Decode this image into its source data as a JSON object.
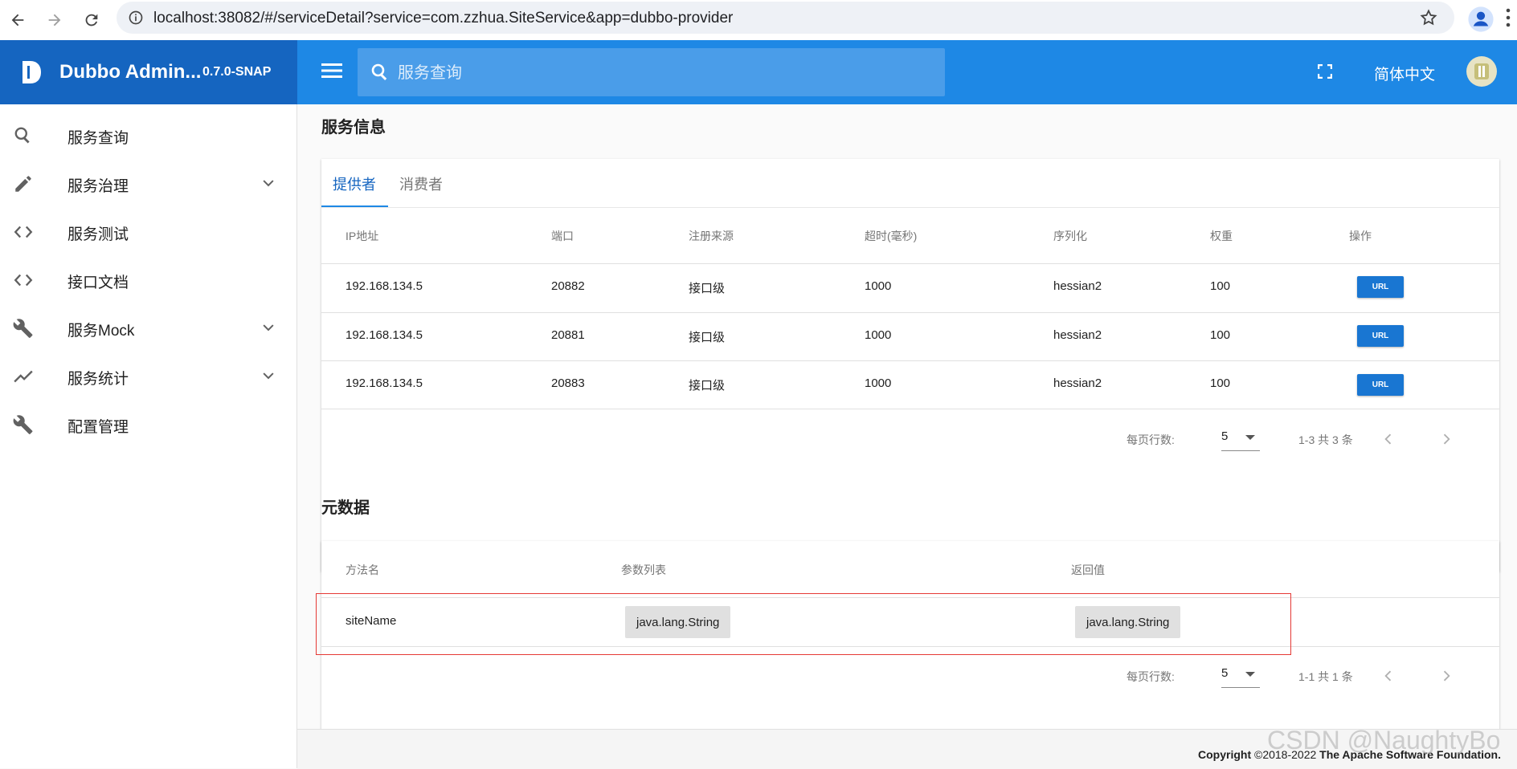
{
  "browser": {
    "url": "localhost:38082/#/serviceDetail?service=com.zzhua.SiteService&app=dubbo-provider"
  },
  "app": {
    "name": "Dubbo Admin...",
    "version": "0.7.0-SNAP",
    "search_placeholder": "服务查询",
    "language": "简体中文"
  },
  "sidebar": {
    "items": [
      {
        "label": "服务查询",
        "icon": "search-icon"
      },
      {
        "label": "服务治理",
        "icon": "pencil-icon",
        "expandable": true
      },
      {
        "label": "服务测试",
        "icon": "code-icon"
      },
      {
        "label": "接口文档",
        "icon": "code-icon"
      },
      {
        "label": "服务Mock",
        "icon": "wrench-icon",
        "expandable": true
      },
      {
        "label": "服务统计",
        "icon": "trending-icon",
        "expandable": true
      },
      {
        "label": "配置管理",
        "icon": "wrench-icon"
      }
    ]
  },
  "service_info": {
    "title": "服务信息",
    "tabs": [
      {
        "label": "提供者",
        "active": true
      },
      {
        "label": "消费者",
        "active": false
      }
    ],
    "headers": [
      "IP地址",
      "端口",
      "注册来源",
      "超时(毫秒)",
      "序列化",
      "权重",
      "操作"
    ],
    "rows": [
      [
        "192.168.134.5",
        "20882",
        "接口级",
        "1000",
        "hessian2",
        "100",
        "URL"
      ],
      [
        "192.168.134.5",
        "20881",
        "接口级",
        "1000",
        "hessian2",
        "100",
        "URL"
      ],
      [
        "192.168.134.5",
        "20883",
        "接口级",
        "1000",
        "hessian2",
        "100",
        "URL"
      ]
    ],
    "pager": {
      "rows_per_page_label": "每页行数:",
      "rows_per_page": "5",
      "range": "1-3 共 3 条"
    }
  },
  "metadata": {
    "title": "元数据",
    "headers": [
      "方法名",
      "参数列表",
      "返回值"
    ],
    "rows": [
      [
        "siteName",
        "java.lang.String",
        "java.lang.String"
      ]
    ],
    "pager": {
      "rows_per_page_label": "每页行数:",
      "rows_per_page": "5",
      "range": "1-1 共 1 条"
    }
  },
  "footer": {
    "copyright_prefix": "Copyright",
    "copyright_years": "©2018-2022",
    "copyright_owner": "The Apache Software Foundation."
  },
  "watermark": "CSDN @NaughtyBo",
  "colors": {
    "brand": "#1565c0",
    "topbar": "#1e88e5",
    "button": "#1976d2",
    "highlight": "#e53935"
  }
}
